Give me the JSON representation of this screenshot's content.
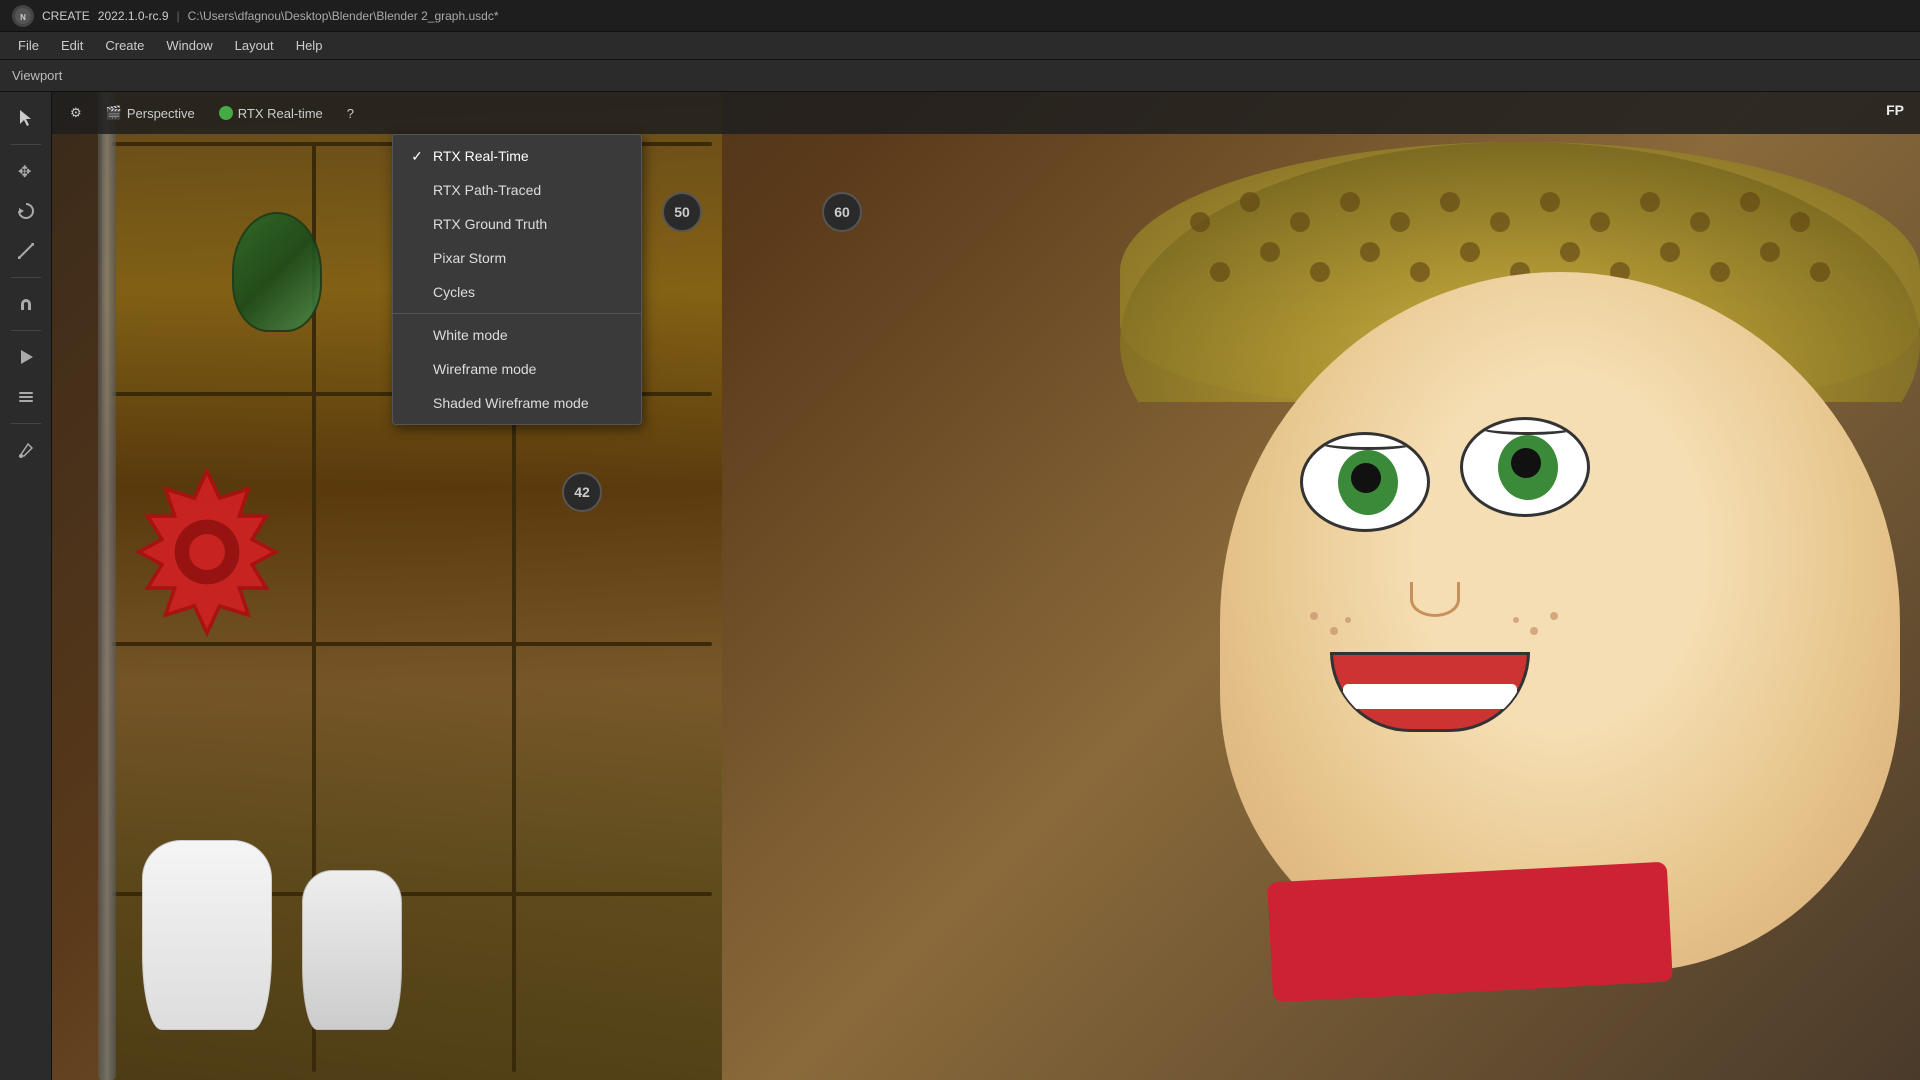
{
  "titleBar": {
    "appName": "CREATE",
    "version": "2022.1.0-rc.9",
    "separator": "|",
    "filePath": "C:\\Users\\dfagnou\\Desktop\\Blender\\Blender 2_graph.usdc*"
  },
  "menuBar": {
    "items": [
      "File",
      "Edit",
      "Create",
      "Window",
      "Layout",
      "Help"
    ]
  },
  "viewportLabel": "Viewport",
  "viewport": {
    "perspectiveLabel": "Perspective",
    "rtxLabel": "RTX Real-time",
    "fpLabel": "FP",
    "gearIcon": "⚙",
    "cameraIcon": "🎬",
    "rtxIcon": "●",
    "questionIcon": "?"
  },
  "dropdown": {
    "items": [
      {
        "id": "rtx-realtime",
        "label": "RTX Real-Time",
        "checked": true
      },
      {
        "id": "rtx-pathtraced",
        "label": "RTX Path-Traced",
        "checked": false
      },
      {
        "id": "rtx-groundtruth",
        "label": "RTX Ground Truth",
        "checked": false
      },
      {
        "id": "pixar-storm",
        "label": "Pixar Storm",
        "checked": false
      },
      {
        "id": "cycles",
        "label": "Cycles",
        "checked": false
      }
    ],
    "modeItems": [
      {
        "id": "white-mode",
        "label": "White mode"
      },
      {
        "id": "wireframe-mode",
        "label": "Wireframe mode"
      },
      {
        "id": "shaded-wireframe-mode",
        "label": "Shaded Wireframe mode"
      }
    ]
  },
  "toolbar": {
    "tools": [
      {
        "id": "select",
        "icon": "↖",
        "active": true
      },
      {
        "id": "move",
        "icon": "✥"
      },
      {
        "id": "rotate",
        "icon": "↻"
      },
      {
        "id": "scale",
        "icon": "⤢"
      },
      {
        "id": "magnet",
        "icon": "⊓"
      },
      {
        "id": "play",
        "icon": "▶"
      },
      {
        "id": "layers",
        "icon": "≡"
      },
      {
        "id": "paint",
        "icon": "✏"
      }
    ]
  },
  "badges": {
    "badge50": "50",
    "badge60": "60",
    "badge42": "42"
  },
  "colors": {
    "titleBg": "#1e1e1e",
    "menuBg": "#2b2b2b",
    "toolbarBg": "#2b2b2b",
    "dropdownBg": "#3a3a3a",
    "accent": "#4a9f4a"
  }
}
